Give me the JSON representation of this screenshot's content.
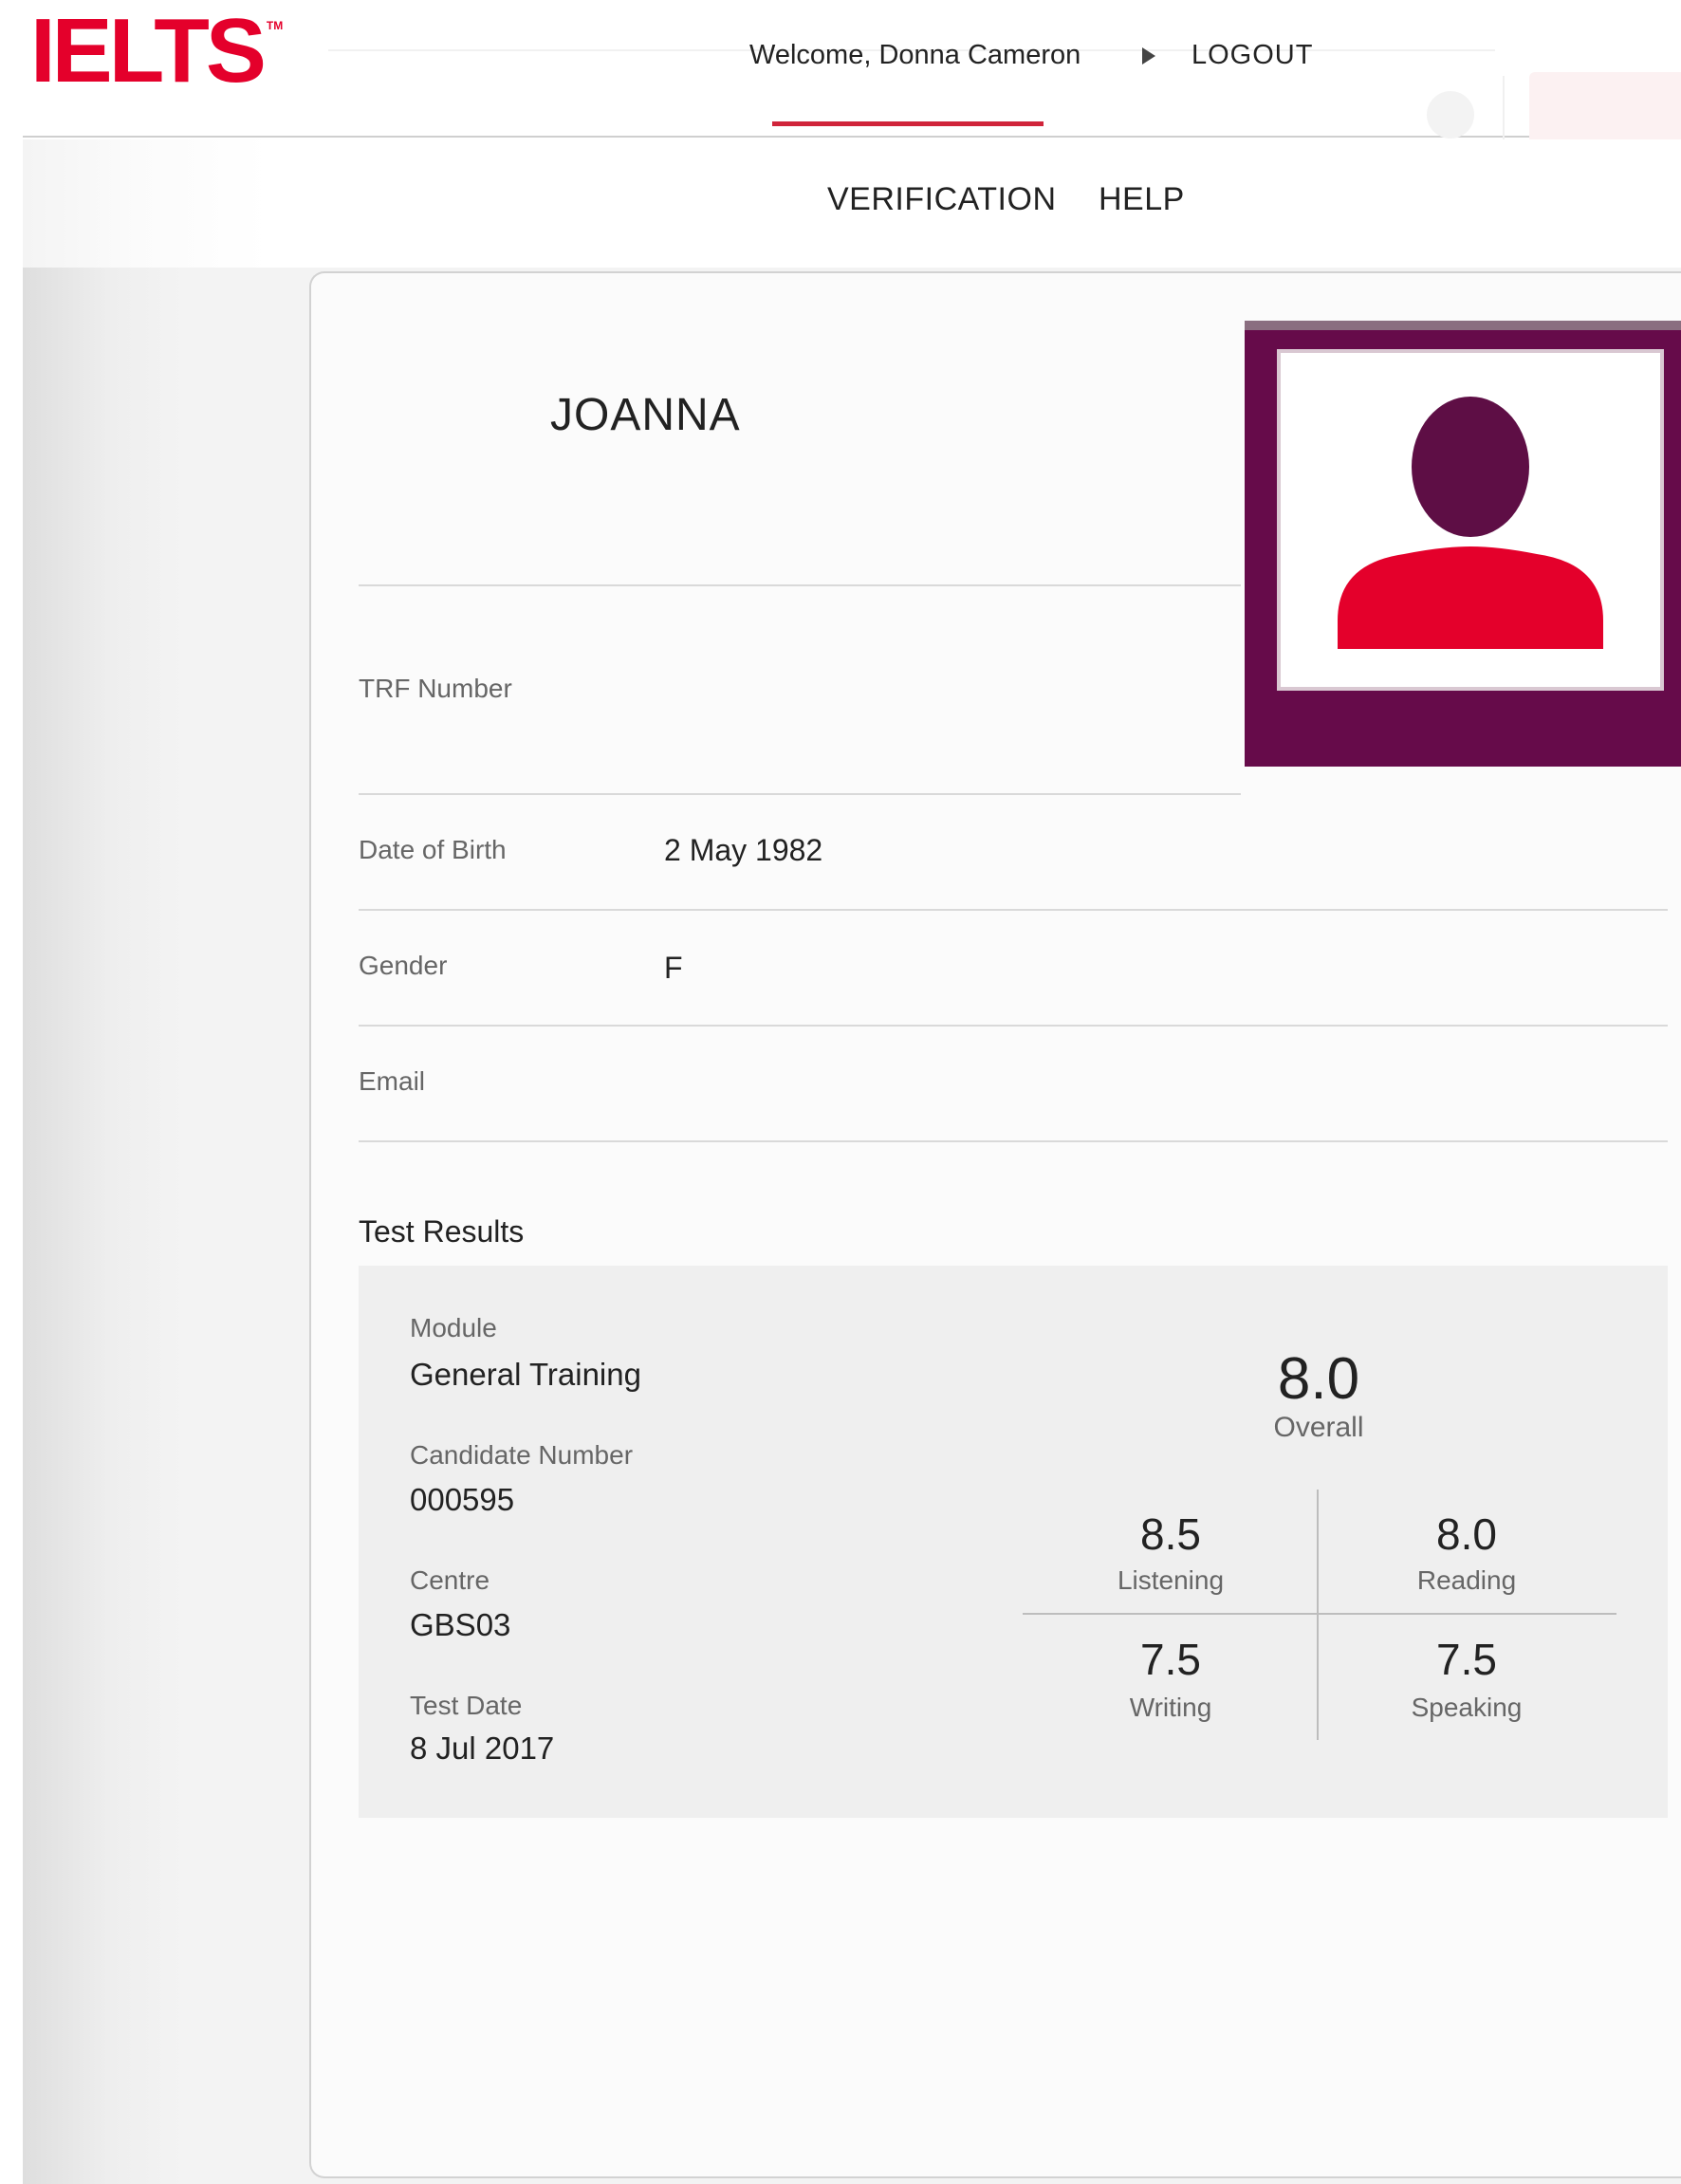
{
  "header": {
    "logo_text": "IELTS",
    "logo_tm": "TM",
    "welcome_text": "Welcome, Donna Cameron",
    "logout_label": "LOGOUT"
  },
  "nav": {
    "tabs": [
      {
        "label": "VERIFICATION",
        "active": true
      },
      {
        "label": "HELP",
        "active": false
      }
    ]
  },
  "candidate": {
    "name": "JOANNA",
    "fields": {
      "trf_label": "TRF Number",
      "trf_value": "",
      "dob_label": "Date of Birth",
      "dob_value": "2 May 1982",
      "gender_label": "Gender",
      "gender_value": "F",
      "email_label": "Email",
      "email_value": ""
    },
    "photo_icon": "user-avatar-icon"
  },
  "results": {
    "title": "Test Results",
    "module_label": "Module",
    "module_value": "General Training",
    "candidate_number_label": "Candidate Number",
    "candidate_number_value": "000595",
    "centre_label": "Centre",
    "centre_value": "GBS03",
    "test_date_label": "Test Date",
    "test_date_value": "8 Jul 2017",
    "overall_score": "8.0",
    "overall_label": "Overall",
    "listening_score": "8.5",
    "listening_label": "Listening",
    "reading_score": "8.0",
    "reading_label": "Reading",
    "writing_score": "7.5",
    "writing_label": "Writing",
    "speaking_score": "7.5",
    "speaking_label": "Speaking"
  },
  "colors": {
    "brand_red": "#e4002b",
    "tab_indicator": "#d0243a",
    "photo_frame": "#660b4a",
    "avatar_body": "#e4002b",
    "avatar_head": "#5e0e45"
  }
}
